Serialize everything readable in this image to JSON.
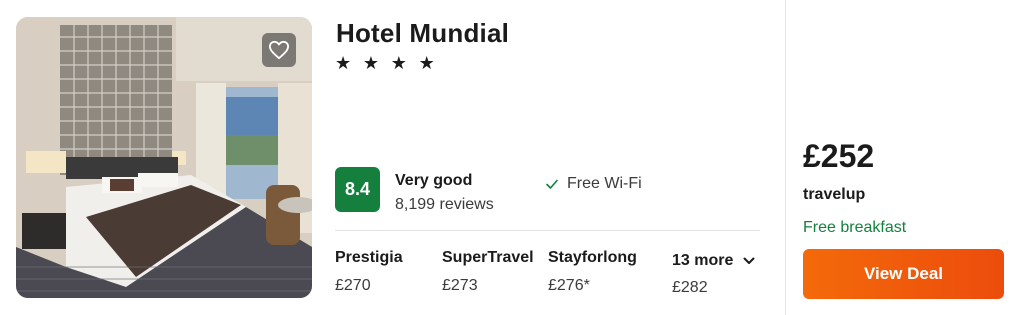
{
  "hotel": {
    "name": "Hotel Mundial",
    "stars_display": "★ ★ ★ ★",
    "star_count": 4
  },
  "rating": {
    "score": "8.4",
    "label": "Very good",
    "reviews": "8,199 reviews",
    "badge_color": "#15803d"
  },
  "amenities": [
    {
      "label": "Free Wi-Fi",
      "icon": "check-icon"
    }
  ],
  "providers": [
    {
      "name": "Prestigia",
      "price": "£270"
    },
    {
      "name": "SuperTravel",
      "price": "£273"
    },
    {
      "name": "Stayforlong",
      "price": "£276*"
    }
  ],
  "more_providers": {
    "label": "13 more",
    "price": "£282",
    "icon": "chevron-down-icon"
  },
  "deal": {
    "price": "£252",
    "provider": "travelup",
    "extra": "Free breakfast",
    "button_label": "View Deal",
    "button_color": "#f25c05"
  },
  "photo": {
    "icon": "heart-icon"
  }
}
